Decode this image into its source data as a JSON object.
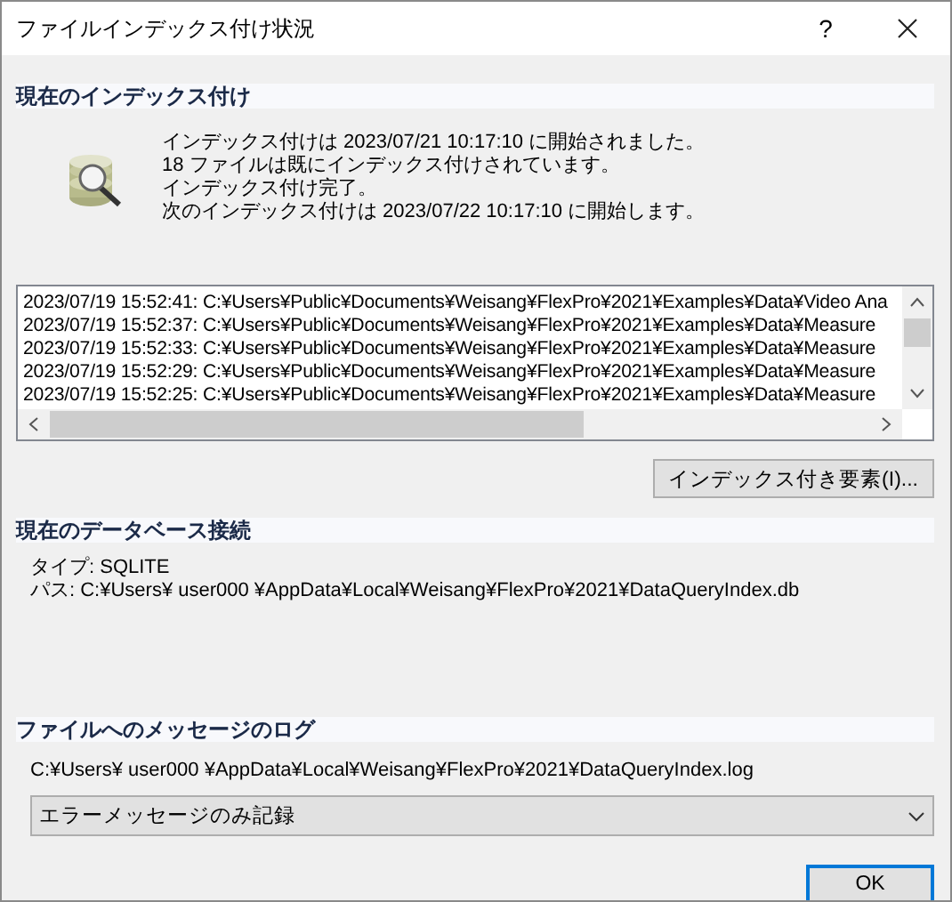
{
  "window": {
    "title": "ファイルインデックス付け状況",
    "help": "?"
  },
  "indexing": {
    "heading": "現在のインデックス付け",
    "lines": [
      "インデックス付けは 2023/07/21 10:17:10 に開始されました。",
      "18 ファイルは既にインデックス付けされています。",
      "インデックス付け完了。",
      "次のインデックス付けは 2023/07/22 10:17:10 に開始します。"
    ],
    "log": [
      "2023/07/19 15:52:41: C:¥Users¥Public¥Documents¥Weisang¥FlexPro¥2021¥Examples¥Data¥Video Ana",
      "2023/07/19 15:52:37: C:¥Users¥Public¥Documents¥Weisang¥FlexPro¥2021¥Examples¥Data¥Measure",
      "2023/07/19 15:52:33: C:¥Users¥Public¥Documents¥Weisang¥FlexPro¥2021¥Examples¥Data¥Measure",
      "2023/07/19 15:52:29: C:¥Users¥Public¥Documents¥Weisang¥FlexPro¥2021¥Examples¥Data¥Measure",
      "2023/07/19 15:52:25: C:¥Users¥Public¥Documents¥Weisang¥FlexPro¥2021¥Examples¥Data¥Measure"
    ],
    "button": "インデックス付き要素(I)..."
  },
  "database": {
    "heading": "現在のデータベース接続",
    "lines": [
      "タイプ: SQLITE",
      "パス: C:¥Users¥ user000 ¥AppData¥Local¥Weisang¥FlexPro¥2021¥DataQueryIndex.db"
    ]
  },
  "logging": {
    "heading": "ファイルへのメッセージのログ",
    "path": "C:¥Users¥ user000 ¥AppData¥Local¥Weisang¥FlexPro¥2021¥DataQueryIndex.log",
    "mode": "エラーメッセージのみ記録"
  },
  "ok_button": "OK"
}
